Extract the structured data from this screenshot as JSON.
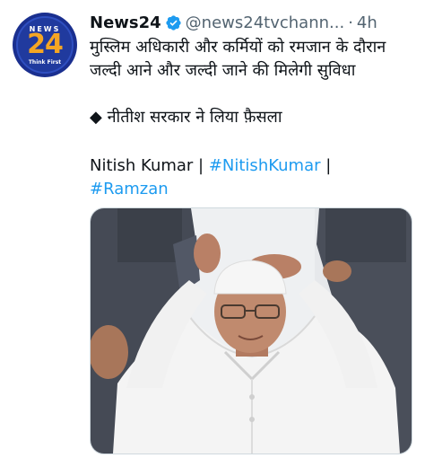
{
  "account": {
    "name": "News24",
    "handle": "@news24tvchann...",
    "separator": "·",
    "time": "4h",
    "avatar_line1": "NEWS",
    "avatar_line2": "24",
    "avatar_line3": "Think First"
  },
  "tweet": {
    "line1": "मुस्लिम अधिकारी और कर्मियों को रमजान के दौरान",
    "line2": "जल्दी आने और जल्दी जाने की मिलेगी सुविधा",
    "bullet": "◆ नीतीश सरकार ने लिया फ़ैसला",
    "mention_text": "Nitish Kumar | ",
    "hashtag1": "#NitishKumar",
    "separator_after": " |",
    "hashtag2": "#Ramzan"
  },
  "colors": {
    "link": "#1d9bf0",
    "verified": "#1d9bf0",
    "secondary_text": "#536471"
  },
  "icons": {
    "verified": "verified-badge-icon"
  }
}
